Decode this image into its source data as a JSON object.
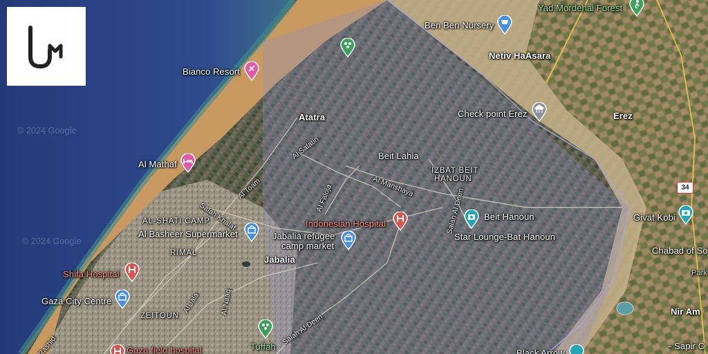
{
  "map": {
    "watermark": "© 2024 Google",
    "labels": {
      "ben_ben_nursery": "Ben Ben Nursery",
      "yad_mordehai_forest": "Yad Mordehai Forest",
      "netiv_haasara": "Netiv HaAsara",
      "bianco_resort": "Bianco Resort",
      "check_point_erez": "Check point Erez",
      "erez": "Erez",
      "atatra": "Atatra",
      "al_salatin": "Al Salatin",
      "beit_lahia": "Beit Lahia",
      "izbat_beit_hanoun_1": "'IZBAT BEIT",
      "izbat_beit_hanoun_2": "HANOUN",
      "al_mathaf": "Al Mathaf",
      "al_toam": "Al Toam",
      "al_manshaya": "Al Manshaya",
      "al_faloja": "Al Faloja",
      "salah_al_deen_north": "Salah Al Deen",
      "salah_khalaf": "Salah Khalaf",
      "beit_hanoun": "Beit Hanoun",
      "givat_kobi": "Givat Kobi",
      "al_shati_camp": "AL-SHATI CAMP",
      "indonesian_hospital": "Indonesian Hospital",
      "al_basheer_supermarket": "Al Basheer Supermarket",
      "jabalia_refugee_1": "Jabalia refugee",
      "jabalia_refugee_2": "camp market",
      "star_lounge": "Star Lounge-Bat Hanoun",
      "chabad": "Chabad of So",
      "rimal": "RIMAL",
      "jabalia": "Jabalia",
      "shifa_hospital": "Shifa Hospital",
      "park": "Park",
      "gaza_city_centre": "Gaza City Centre",
      "al_jala": "Al Jala",
      "al_naaq": "Al Naaq",
      "zeitoun": "ZEITOUN",
      "nir_am": "Nir Am",
      "salah_al_deen_south": "Salah Al Deen",
      "tuffah": "Tuffah",
      "gaza_field_hospital": "Gaza field hospital",
      "sapir": "- Sapir C",
      "black_arrow": "Black Arrow",
      "rashid": "Rashid",
      "road_34": "34"
    },
    "colors": {
      "sea": "#2f4b8c",
      "shoreline": "#3a7f86",
      "overlay": "#8a8fc8",
      "pin_red": "#d9534f",
      "pin_blue": "#4a8fe0",
      "pin_green": "#3aa05a",
      "pin_pink": "#e05aa8",
      "pin_teal": "#26a6b5",
      "pin_gray": "#8a8f99"
    }
  },
  "logo": {
    "icon": "um-logo"
  }
}
